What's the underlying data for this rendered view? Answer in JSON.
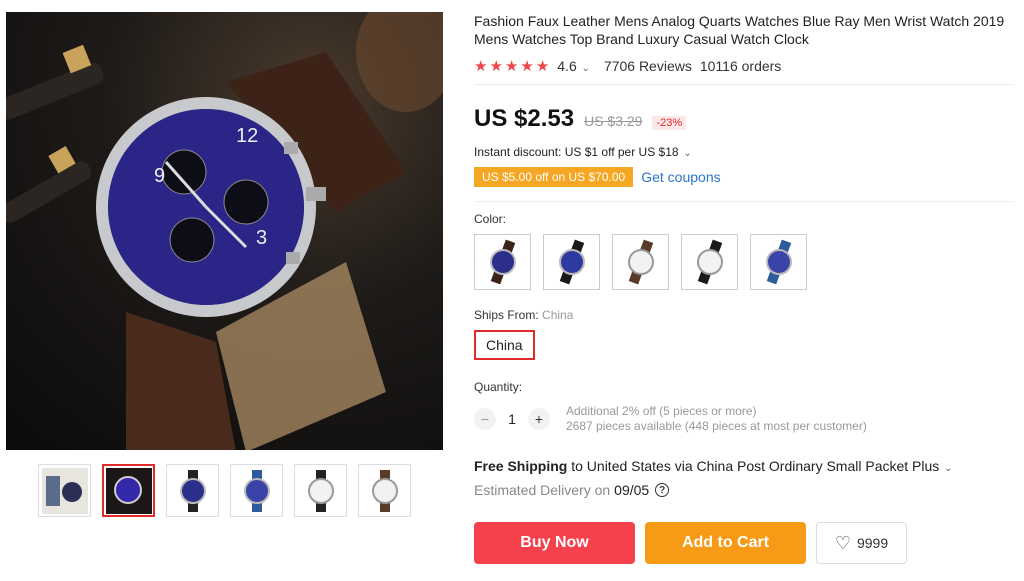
{
  "product": {
    "title": "Fashion Faux Leather Mens Analog Quarts Watches Blue Ray Men Wrist Watch 2019 Mens Watches Top Brand Luxury Casual Watch Clock",
    "rating": "4.6",
    "reviews": "7706 Reviews",
    "orders": "10116 orders"
  },
  "pricing": {
    "price": "US $2.53",
    "old_price": "US $3.29",
    "discount": "-23%",
    "instant_discount": "Instant discount: US $1 off per US $18",
    "coupon_tag": "US $5.00 off on US $70.00",
    "coupon_link": "Get coupons"
  },
  "color": {
    "label": "Color:"
  },
  "ships": {
    "label": "Ships From:",
    "value": "China",
    "selected": "China"
  },
  "quantity": {
    "label": "Quantity:",
    "value": "1",
    "info1": "Additional 2% off (5 pieces or more)",
    "info2": "2687 pieces available (448 pieces at most per customer)"
  },
  "shipping": {
    "free": "Free Shipping",
    "detail": "to United States via China Post Ordinary Small Packet Plus",
    "estimated_label": "Estimated Delivery on",
    "estimated_date": "09/05"
  },
  "actions": {
    "buy": "Buy Now",
    "cart": "Add to Cart",
    "wish_count": "9999"
  },
  "colors": {
    "accent_red": "#f4414b",
    "accent_orange": "#f79a15",
    "star": "#f0464a",
    "link": "#2a74c9"
  }
}
